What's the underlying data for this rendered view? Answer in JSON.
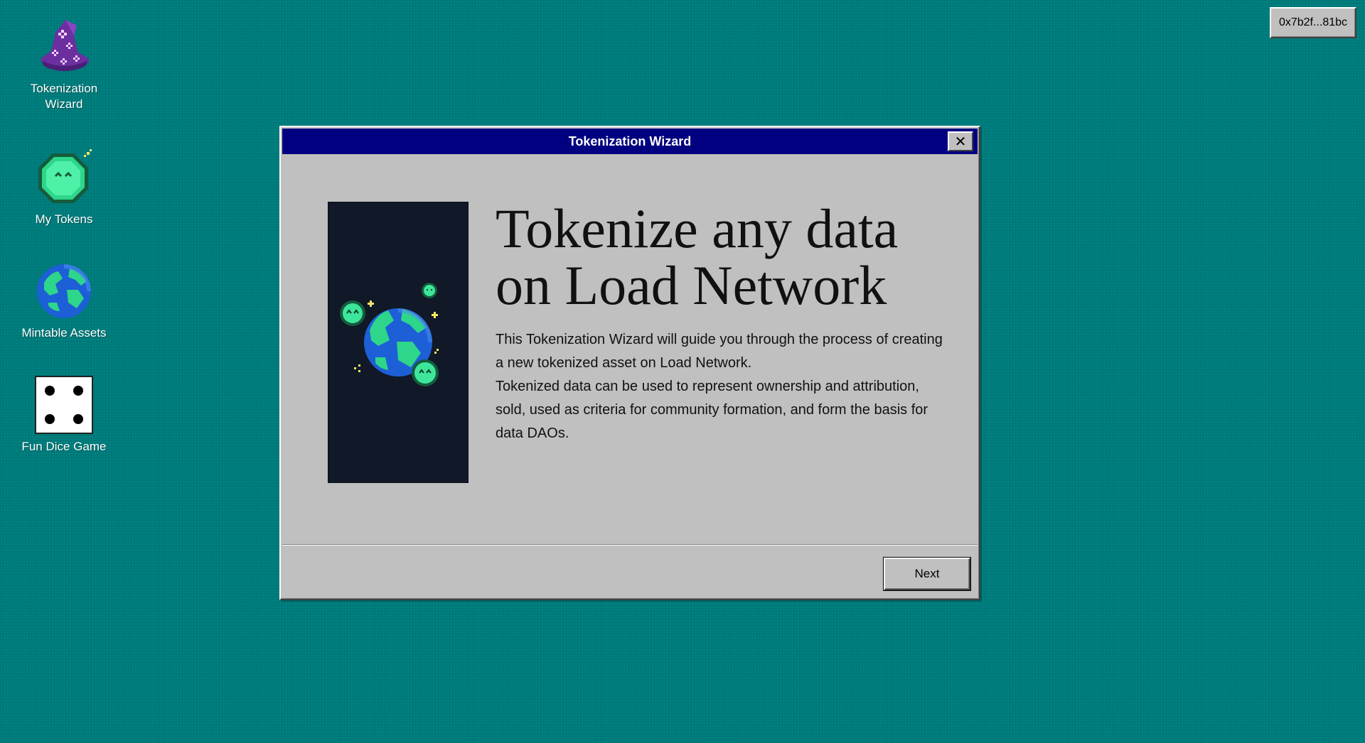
{
  "desktop": {
    "icons": [
      {
        "label": "Tokenization Wizard",
        "icon": "wizard-hat-icon"
      },
      {
        "label": "My Tokens",
        "icon": "token-coin-icon"
      },
      {
        "label": "Mintable Assets",
        "icon": "globe-icon"
      },
      {
        "label": "Fun Dice Game",
        "icon": "dice-icon"
      }
    ]
  },
  "wallet": {
    "address": "0x7b2f...81bc"
  },
  "window": {
    "title": "Tokenization Wizard",
    "close_label": "✕",
    "heading": "Tokenize any data on Load Network",
    "paragraphs": [
      "This Tokenization Wizard will guide you through the process of creating a new tokenized asset on Load Network.",
      "Tokenized data can be used to represent ownership and attribution, sold, used as criteria for community formation, and form the basis for data DAOs."
    ],
    "next_label": "Next"
  },
  "colors": {
    "desktop_bg": "#008080",
    "title_bar": "#000080",
    "window_bg": "#c0c0c0",
    "illustration_bg": "#111827",
    "token_green": "#2dd68a",
    "wizard_purple": "#6b2fa0"
  }
}
